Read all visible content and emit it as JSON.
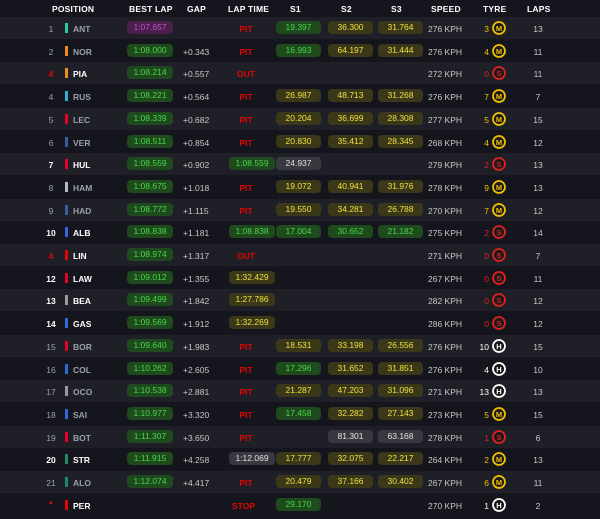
{
  "headers": {
    "position": "POSITION",
    "best_lap": "BEST LAP",
    "gap": "GAP",
    "lap_time": "LAP TIME",
    "s1": "S1",
    "s2": "S2",
    "s3": "S3",
    "speed": "SPEED",
    "tyre": "TYRE",
    "laps": "LAPS"
  },
  "colors": {
    "pit_red": "#e10600",
    "fastest_purple": "#c050c8",
    "personal_green": "#46d848",
    "sector_yellow": "#f0e040",
    "soft_red": "#e02020",
    "medium_yellow": "#f0c000",
    "hard_white": "#ffffff"
  },
  "rows": [
    {
      "pos": "1",
      "pos_style": "dim",
      "team_color": "#2ec4a6",
      "driver": "ANT",
      "best_lap": "1:07.657",
      "best_style": "pur",
      "gap": "",
      "status": "PIT",
      "lap_time": "",
      "lt_style": "",
      "s1": "19.397",
      "s1_style": "g",
      "s2": "36.300",
      "s2_style": "yel",
      "s3": "31.764",
      "s3_style": "yel",
      "speed": "276 KPH",
      "tyre_laps": "3",
      "tyre": "M",
      "tyre_color": "#f0c000",
      "tyre_new": false,
      "laps": "13"
    },
    {
      "pos": "2",
      "pos_style": "dim",
      "team_color": "#f28a1c",
      "driver": "NOR",
      "best_lap": "1:08.000",
      "best_style": "g",
      "gap": "+0.343",
      "status": "PIT",
      "lap_time": "",
      "lt_style": "",
      "s1": "16.993",
      "s1_style": "g",
      "s2": "64.197",
      "s2_style": "yel",
      "s3": "31.444",
      "s3_style": "yel",
      "speed": "276 KPH",
      "tyre_laps": "4",
      "tyre": "M",
      "tyre_color": "#f0c000",
      "tyre_new": false,
      "laps": "11"
    },
    {
      "pos": "4",
      "pos_style": "red",
      "team_color": "#f28a1c",
      "driver": "PIA",
      "best_lap": "1:08.214",
      "best_style": "g",
      "gap": "+0.557",
      "status": "OUT",
      "lap_time": "",
      "lt_style": "",
      "s1": "",
      "s1_style": "",
      "s2": "",
      "s2_style": "",
      "s3": "",
      "s3_style": "",
      "speed": "272 KPH",
      "tyre_laps": "0",
      "tyre": "S",
      "tyre_color": "#e02020",
      "tyre_new": false,
      "laps": "11"
    },
    {
      "pos": "4",
      "pos_style": "dim",
      "team_color": "#27b2d6",
      "driver": "RUS",
      "best_lap": "1:08.221",
      "best_style": "g",
      "gap": "+0.564",
      "status": "PIT",
      "lap_time": "",
      "lt_style": "",
      "s1": "26.987",
      "s1_style": "yel",
      "s2": "48.713",
      "s2_style": "yel",
      "s3": "31.268",
      "s3_style": "yel",
      "speed": "276 KPH",
      "tyre_laps": "7",
      "tyre": "M",
      "tyre_color": "#f0c000",
      "tyre_new": false,
      "laps": "7"
    },
    {
      "pos": "5",
      "pos_style": "dim",
      "team_color": "#e8002d",
      "driver": "LEC",
      "best_lap": "1:08.339",
      "best_style": "g",
      "gap": "+0.682",
      "status": "PIT",
      "lap_time": "",
      "lt_style": "",
      "s1": "20.204",
      "s1_style": "yel",
      "s2": "36.699",
      "s2_style": "yel",
      "s3": "28.308",
      "s3_style": "yel",
      "speed": "277 KPH",
      "tyre_laps": "5",
      "tyre": "M",
      "tyre_color": "#f0c000",
      "tyre_new": false,
      "laps": "15"
    },
    {
      "pos": "6",
      "pos_style": "dim",
      "team_color": "#3a5ba0",
      "driver": "VER",
      "best_lap": "1:08.511",
      "best_style": "g",
      "gap": "+0.854",
      "status": "PIT",
      "lap_time": "",
      "lt_style": "",
      "s1": "20.830",
      "s1_style": "yel",
      "s2": "35.412",
      "s2_style": "yel",
      "s3": "28.345",
      "s3_style": "yel",
      "speed": "268 KPH",
      "tyre_laps": "4",
      "tyre": "M",
      "tyre_color": "#f0c000",
      "tyre_new": false,
      "laps": "12"
    },
    {
      "pos": "7",
      "pos_style": "bold",
      "team_color": "#e8002d",
      "driver": "HUL",
      "best_lap": "1:08.559",
      "best_style": "g",
      "gap": "+0.902",
      "status": "",
      "lap_time": "1:08.559",
      "lt_style": "g",
      "s1": "24.937",
      "s1_style": "grey",
      "s2": "",
      "s2_style": "",
      "s3": "",
      "s3_style": "",
      "speed": "279 KPH",
      "tyre_laps": "2",
      "tyre": "S",
      "tyre_color": "#e02020",
      "tyre_new": false,
      "laps": "13"
    },
    {
      "pos": "8",
      "pos_style": "dim",
      "team_color": "#b6babd",
      "driver": "HAM",
      "best_lap": "1:08.675",
      "best_style": "g",
      "gap": "+1.018",
      "status": "PIT",
      "lap_time": "",
      "lt_style": "",
      "s1": "19.072",
      "s1_style": "yel",
      "s2": "40.941",
      "s2_style": "yel",
      "s3": "31.976",
      "s3_style": "yel",
      "speed": "278 KPH",
      "tyre_laps": "9",
      "tyre": "M",
      "tyre_color": "#f0c000",
      "tyre_new": false,
      "laps": "13"
    },
    {
      "pos": "9",
      "pos_style": "dim",
      "team_color": "#3a5ba0",
      "driver": "HAD",
      "best_lap": "1:08.772",
      "best_style": "g",
      "gap": "+1.115",
      "status": "PIT",
      "lap_time": "",
      "lt_style": "",
      "s1": "19.550",
      "s1_style": "yel",
      "s2": "34.281",
      "s2_style": "yel",
      "s3": "26.788",
      "s3_style": "yel",
      "speed": "270 KPH",
      "tyre_laps": "7",
      "tyre": "M",
      "tyre_color": "#f0c000",
      "tyre_new": false,
      "laps": "12"
    },
    {
      "pos": "10",
      "pos_style": "bold",
      "team_color": "#2f6bd8",
      "driver": "ALB",
      "best_lap": "1:08.838",
      "best_style": "g",
      "gap": "+1.181",
      "status": "",
      "lap_time": "1:08.838",
      "lt_style": "g",
      "s1": "17.004",
      "s1_style": "g",
      "s2": "30.652",
      "s2_style": "g",
      "s3": "21.182",
      "s3_style": "g",
      "speed": "275 KPH",
      "tyre_laps": "2",
      "tyre": "S",
      "tyre_color": "#e02020",
      "tyre_new": false,
      "laps": "14"
    },
    {
      "pos": "4",
      "pos_style": "red",
      "team_color": "#e10600",
      "driver": "LIN",
      "best_lap": "1:08.974",
      "best_style": "g",
      "gap": "+1.317",
      "status": "OUT",
      "lap_time": "",
      "lt_style": "",
      "s1": "",
      "s1_style": "",
      "s2": "",
      "s2_style": "",
      "s3": "",
      "s3_style": "",
      "speed": "271 KPH",
      "tyre_laps": "0",
      "tyre": "S",
      "tyre_color": "#e02020",
      "tyre_new": false,
      "laps": "7"
    },
    {
      "pos": "12",
      "pos_style": "bold",
      "team_color": "#e8002d",
      "driver": "LAW",
      "best_lap": "1:09.012",
      "best_style": "g",
      "gap": "+1.355",
      "status": "",
      "lap_time": "1:32.429",
      "lt_style": "yel",
      "s1": "",
      "s1_style": "",
      "s2": "",
      "s2_style": "",
      "s3": "",
      "s3_style": "",
      "speed": "267 KPH",
      "tyre_laps": "0",
      "tyre": "S",
      "tyre_color": "#e02020",
      "tyre_new": false,
      "laps": "11"
    },
    {
      "pos": "13",
      "pos_style": "bold",
      "team_color": "#9a9a9a",
      "driver": "BEA",
      "best_lap": "1:09.499",
      "best_style": "g",
      "gap": "+1.842",
      "status": "",
      "lap_time": "1:27.786",
      "lt_style": "yel",
      "s1": "",
      "s1_style": "",
      "s2": "",
      "s2_style": "",
      "s3": "",
      "s3_style": "",
      "speed": "282 KPH",
      "tyre_laps": "0",
      "tyre": "S",
      "tyre_color": "#e02020",
      "tyre_new": false,
      "laps": "12"
    },
    {
      "pos": "14",
      "pos_style": "bold",
      "team_color": "#2f6bd8",
      "driver": "GAS",
      "best_lap": "1:09.569",
      "best_style": "g",
      "gap": "+1.912",
      "status": "",
      "lap_time": "1:32.269",
      "lt_style": "yel",
      "s1": "",
      "s1_style": "",
      "s2": "",
      "s2_style": "",
      "s3": "",
      "s3_style": "",
      "speed": "286 KPH",
      "tyre_laps": "0",
      "tyre": "S",
      "tyre_color": "#e02020",
      "tyre_new": false,
      "laps": "12"
    },
    {
      "pos": "15",
      "pos_style": "dim",
      "team_color": "#e8002d",
      "driver": "BOR",
      "best_lap": "1:09.640",
      "best_style": "g",
      "gap": "+1.983",
      "status": "PIT",
      "lap_time": "",
      "lt_style": "",
      "s1": "18.531",
      "s1_style": "yel",
      "s2": "33.198",
      "s2_style": "yel",
      "s3": "26.556",
      "s3_style": "yel",
      "speed": "276 KPH",
      "tyre_laps": "10",
      "tyre": "H",
      "tyre_color": "#ffffff",
      "tyre_new": false,
      "laps": "15"
    },
    {
      "pos": "16",
      "pos_style": "dim",
      "team_color": "#2f6bd8",
      "driver": "COL",
      "best_lap": "1:10.262",
      "best_style": "g",
      "gap": "+2.605",
      "status": "PIT",
      "lap_time": "",
      "lt_style": "",
      "s1": "17.296",
      "s1_style": "g",
      "s2": "31.652",
      "s2_style": "yel",
      "s3": "31.851",
      "s3_style": "yel",
      "speed": "276 KPH",
      "tyre_laps": "4",
      "tyre": "H",
      "tyre_color": "#ffffff",
      "tyre_new": false,
      "laps": "10"
    },
    {
      "pos": "17",
      "pos_style": "dim",
      "team_color": "#9a9a9a",
      "driver": "OCO",
      "best_lap": "1:10.538",
      "best_style": "g",
      "gap": "+2.881",
      "status": "PIT",
      "lap_time": "",
      "lt_style": "",
      "s1": "21.287",
      "s1_style": "yel",
      "s2": "47.203",
      "s2_style": "yel",
      "s3": "31.096",
      "s3_style": "yel",
      "speed": "271 KPH",
      "tyre_laps": "13",
      "tyre": "H",
      "tyre_color": "#ffffff",
      "tyre_new": false,
      "laps": "13"
    },
    {
      "pos": "18",
      "pos_style": "dim",
      "team_color": "#2f6bd8",
      "driver": "SAI",
      "best_lap": "1:10.977",
      "best_style": "g",
      "gap": "+3.320",
      "status": "PIT",
      "lap_time": "",
      "lt_style": "",
      "s1": "17.458",
      "s1_style": "g",
      "s2": "32.282",
      "s2_style": "yel",
      "s3": "27.143",
      "s3_style": "yel",
      "speed": "273 KPH",
      "tyre_laps": "5",
      "tyre": "M",
      "tyre_color": "#f0c000",
      "tyre_new": false,
      "laps": "15"
    },
    {
      "pos": "19",
      "pos_style": "dim",
      "team_color": "#e8002d",
      "driver": "BOT",
      "best_lap": "1:11.307",
      "best_style": "g",
      "gap": "+3.650",
      "status": "PIT",
      "lap_time": "",
      "lt_style": "",
      "s1": "",
      "s1_style": "",
      "s2": "81.301",
      "s2_style": "grey",
      "s3": "63.168",
      "s3_style": "grey",
      "speed": "278 KPH",
      "tyre_laps": "1",
      "tyre": "S",
      "tyre_color": "#e02020",
      "tyre_new": false,
      "laps": "6"
    },
    {
      "pos": "20",
      "pos_style": "bold",
      "team_color": "#1f8a6a",
      "driver": "STR",
      "best_lap": "1:11.915",
      "best_style": "g",
      "gap": "+4.258",
      "status": "",
      "lap_time": "1:12.069",
      "lt_style": "grey",
      "s1": "17.777",
      "s1_style": "yel",
      "s2": "32.075",
      "s2_style": "yel",
      "s3": "22.217",
      "s3_style": "yel",
      "speed": "264 KPH",
      "tyre_laps": "2",
      "tyre": "M",
      "tyre_color": "#f0c000",
      "tyre_new": false,
      "laps": "13"
    },
    {
      "pos": "21",
      "pos_style": "dim",
      "team_color": "#1f8a6a",
      "driver": "ALO",
      "best_lap": "1:12.074",
      "best_style": "g",
      "gap": "+4.417",
      "status": "PIT",
      "lap_time": "",
      "lt_style": "",
      "s1": "20.479",
      "s1_style": "yel",
      "s2": "37.166",
      "s2_style": "yel",
      "s3": "30.402",
      "s3_style": "yel",
      "speed": "267 KPH",
      "tyre_laps": "6",
      "tyre": "M",
      "tyre_color": "#f0c000",
      "tyre_new": false,
      "laps": "11"
    },
    {
      "pos": "",
      "pos_style": "red",
      "pos_marker": true,
      "team_color": "#e10600",
      "driver": "PER",
      "best_lap": "",
      "best_style": "",
      "gap": "",
      "status": "STOP",
      "lap_time": "",
      "lt_style": "",
      "s1": "29.170",
      "s1_style": "g",
      "s2": "",
      "s2_style": "",
      "s3": "",
      "s3_style": "",
      "speed": "270 KPH",
      "tyre_laps": "1",
      "tyre": "H",
      "tyre_color": "#ffffff",
      "tyre_new": false,
      "laps": "2"
    }
  ]
}
